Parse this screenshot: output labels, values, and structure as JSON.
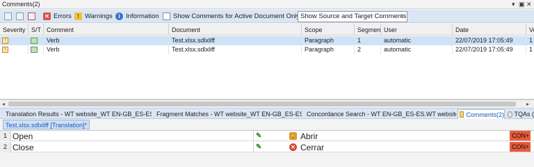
{
  "window": {
    "title": "Comments(2)",
    "controls": [
      "▾",
      "▣",
      "✕"
    ]
  },
  "toolbar": {
    "errors_label": "Errors",
    "warnings_label": "Warnings",
    "information_label": "Information",
    "active_doc_label": "Show Comments for Active Document Only",
    "filter_select_value": "Show Source and Target Comments"
  },
  "grid": {
    "columns": [
      "Severity",
      "S/T",
      "Comment",
      "Document",
      "Scope",
      "Segmen",
      "User",
      "Date",
      "Ve"
    ],
    "rows": [
      {
        "comment": "Verb",
        "document": "Test.xlsx.sdlxliff",
        "scope": "Paragraph",
        "segment": "1",
        "user": "automatic",
        "date": "22/07/2019 17:05:49",
        "version": "1",
        "selected": true
      },
      {
        "comment": "Verb",
        "document": "Test.xlsx.sdlxliff",
        "scope": "Paragraph",
        "segment": "2",
        "user": "automatic",
        "date": "22/07/2019 17:05:49",
        "version": "1",
        "selected": false
      }
    ]
  },
  "tabs": [
    {
      "label": "Translation Results - WT website_WT EN-GB_ES-ES"
    },
    {
      "label": "Fragment Matches - WT website_WT EN-GB_ES-ES"
    },
    {
      "label": "Concordance Search - WT  EN-GB_ES-ES.WT website..."
    },
    {
      "label": "Comments(2)"
    },
    {
      "label": "TQAs ("
    }
  ],
  "editor": {
    "doc_tab": "Test.xlsx.sdlxliff [Translation]*",
    "rows": [
      {
        "num": "1",
        "source": "Open",
        "target": "Abrir",
        "status": "CON+",
        "status_icon": "lock-icon"
      },
      {
        "num": "2",
        "source": "Close",
        "target": "Cerrar",
        "status": "CON+",
        "status_icon": "error-icon"
      }
    ]
  },
  "colors": {
    "toolbar_bg": "#dbe6f4",
    "selected_row": "#cfe2f7",
    "status_badge": "#e85a3c",
    "link": "#1a56b8"
  }
}
